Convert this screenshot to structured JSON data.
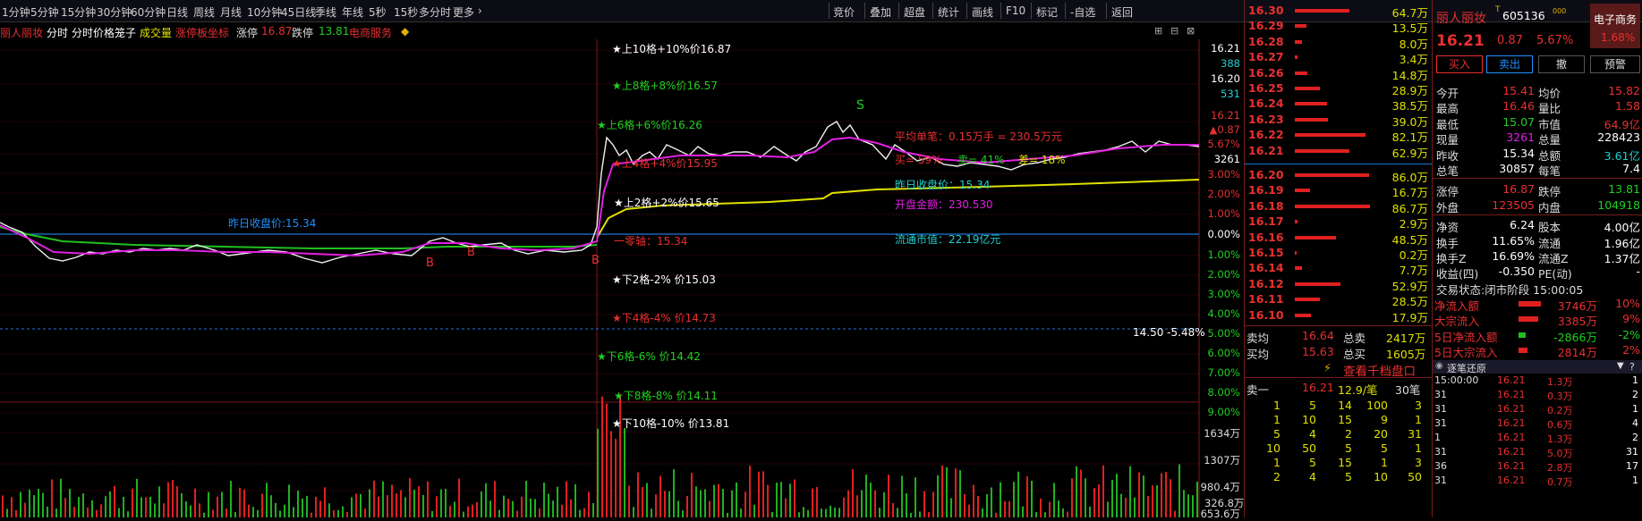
{
  "toolbar": {
    "periods": [
      "1分钟",
      "5分钟",
      "15分钟",
      "30分钟",
      "60分钟",
      "日线",
      "周线",
      "月线",
      "10分钟",
      "45日线",
      "季线",
      "年线",
      "5秒",
      "15秒",
      "多分时",
      "更多"
    ],
    "right": [
      "竞价",
      "叠加",
      "超盘",
      "统计",
      "画线",
      "F10",
      "标记",
      "-自选",
      "返回"
    ]
  },
  "chart_header": {
    "stock_name": "丽人丽妆",
    "tab_time": "分时",
    "tab_cage": "分时价格笼子",
    "volume": "成交量",
    "limit_coord": "涨停板坐标",
    "limit_up_label": "涨停",
    "limit_up_value": "16.87",
    "limit_down_label": "跌停",
    "limit_down_value": "13.81",
    "sector": "电商服务"
  },
  "cage_labels": {
    "up10": "★上10格+10%价16.87",
    "up8": "★上8格+8%价16.57",
    "up6": "★上6格+6%价16.26",
    "up4": "★上4格+4%价15.95",
    "up2": "★上2格+2%价15.65",
    "zero": "一零轴：15.34",
    "down2": "★下2格-2% 价15.03",
    "down4": "★下4格-4% 价14.73",
    "down6": "★下6格-6% 价14.42",
    "down8": "★下8格-8% 价14.11",
    "down10": "★下10格-10% 价13.81"
  },
  "annotations": {
    "prev_close_line": "昨日收盘价:15.34",
    "prev_close_info": "昨日收盘价：15.34",
    "avg_trade": "平均单笔：0.15万手 = 230.5万元",
    "buy_pct": "买= 59%",
    "sell_pct": "卖= 41%",
    "diff_pct": "差= 18%",
    "open_amount": "开盘金额：230.530",
    "float_mcap": "流通市值：22.19亿元",
    "sig_s": "S",
    "sig_b1": "B",
    "sig_b2": "B",
    "sig_b3": "B",
    "low_line": "14.50 -5.48%"
  },
  "right_axis": {
    "price_hi": "16.21",
    "vol_a": "388",
    "price_a": "16.20",
    "vol_b": "531",
    "price_cur": "16.21",
    "chg": "▲0.87",
    "chg_pct": "5.67%",
    "vol_c": "3261",
    "pct_up": [
      "3.00%",
      "2.00%",
      "1.00%"
    ],
    "pct_zero": "0.00%",
    "pct_down": [
      "1.00%",
      "2.00%",
      "3.00%",
      "4.00%",
      "5.00%",
      "6.00%",
      "7.00%",
      "8.00%",
      "9.00%"
    ],
    "vol_ticks": [
      "1634万",
      "1307万",
      "980.4万",
      "653.6万",
      "326.8万"
    ]
  },
  "orderbook": {
    "asks": [
      {
        "price": "16.30",
        "vol": "64.7万",
        "bar": 0.55
      },
      {
        "price": "16.29",
        "vol": "13.5万",
        "bar": 0.12
      },
      {
        "price": "16.28",
        "vol": "8.0万",
        "bar": 0.07
      },
      {
        "price": "16.27",
        "vol": "3.4万",
        "bar": 0.03
      },
      {
        "price": "16.26",
        "vol": "14.8万",
        "bar": 0.13
      },
      {
        "price": "16.25",
        "vol": "28.9万",
        "bar": 0.25
      },
      {
        "price": "16.24",
        "vol": "38.5万",
        "bar": 0.33
      },
      {
        "price": "16.23",
        "vol": "39.0万",
        "bar": 0.34
      },
      {
        "price": "16.22",
        "vol": "82.1万",
        "bar": 0.72
      },
      {
        "price": "16.21",
        "vol": "62.9万",
        "bar": 0.55
      }
    ],
    "bids": [
      {
        "price": "16.20",
        "vol": "86.0万",
        "bar": 0.75
      },
      {
        "price": "16.19",
        "vol": "16.7万",
        "bar": 0.15
      },
      {
        "price": "16.18",
        "vol": "86.7万",
        "bar": 0.76
      },
      {
        "price": "16.17",
        "vol": "2.9万",
        "bar": 0.03
      },
      {
        "price": "16.16",
        "vol": "48.5万",
        "bar": 0.42
      },
      {
        "price": "16.15",
        "vol": "0.2万",
        "bar": 0.01
      },
      {
        "price": "16.14",
        "vol": "7.7万",
        "bar": 0.07
      },
      {
        "price": "16.12",
        "vol": "52.9万",
        "bar": 0.46
      },
      {
        "price": "16.11",
        "vol": "28.5万",
        "bar": 0.25
      },
      {
        "price": "16.10",
        "vol": "17.9万",
        "bar": 0.16
      }
    ],
    "avg_ask_label": "卖均",
    "avg_ask": "16.64",
    "total_ask_label": "总卖",
    "total_ask": "2417万",
    "avg_bid_label": "买均",
    "avg_bid": "15.63",
    "total_bid_label": "总买",
    "total_bid": "1605万",
    "view_more": "查看千档盘口",
    "sell1_label": "卖一",
    "sell1_price": "16.21",
    "sell1_perorder": "12.9/笔",
    "sell1_count": "30笔",
    "queue": [
      [
        "1",
        "5",
        "14",
        "100",
        "3"
      ],
      [
        "1",
        "10",
        "15",
        "9",
        "1"
      ],
      [
        "5",
        "4",
        "2",
        "20",
        "31"
      ],
      [
        "10",
        "50",
        "5",
        "5",
        "1"
      ],
      [
        "1",
        "5",
        "15",
        "1",
        "3"
      ],
      [
        "2",
        "4",
        "5",
        "10",
        "50"
      ]
    ]
  },
  "quote": {
    "name": "丽人丽妆",
    "code": "605136",
    "sector_badge": "电子商务",
    "sector_badge_pct": "1.68%",
    "price": "16.21",
    "change": "0.87",
    "change_pct": "5.67%",
    "buttons": [
      "买入",
      "卖出",
      "撤",
      "预警"
    ],
    "rows": [
      [
        "今开",
        "15.41",
        "均价",
        "15.82"
      ],
      [
        "最高",
        "16.46",
        "量比",
        "1.58"
      ],
      [
        "最低",
        "15.07",
        "市值",
        "64.9亿"
      ],
      [
        "现量",
        "3261",
        "总量",
        "228423"
      ],
      [
        "昨收",
        "15.34",
        "总额",
        "3.61亿"
      ],
      [
        "总笔",
        "30857",
        "每笔",
        "7.4"
      ]
    ],
    "rows2": [
      [
        "涨停",
        "16.87",
        "跌停",
        "13.81"
      ],
      [
        "外盘",
        "123505",
        "内盘",
        "104918"
      ]
    ],
    "rows3": [
      [
        "净资",
        "6.24",
        "股本",
        "4.00亿"
      ],
      [
        "换手",
        "11.65%",
        "流通",
        "1.96亿"
      ],
      [
        "换手Z",
        "16.69%",
        "流通Z",
        "1.37亿"
      ],
      [
        "收益(四)",
        "-0.350",
        "PE(动)",
        "-"
      ]
    ],
    "trade_state": "交易状态:闭市阶段 15:00:05",
    "flows": [
      {
        "label": "净流入额",
        "value": "3746万",
        "pct": "10%",
        "bar": 0.9,
        "color": "#e02020"
      },
      {
        "label": "大宗流入",
        "value": "3385万",
        "pct": "9%",
        "bar": 0.8,
        "color": "#e02020"
      },
      {
        "label": "5日净流入额",
        "value": "-2866万",
        "pct": "-2%",
        "bar": 0.3,
        "color": "#20c020"
      },
      {
        "label": "5日大宗流入",
        "value": "2814万",
        "pct": "2%",
        "bar": 0.35,
        "color": "#e02020"
      }
    ],
    "tick_title": "逐笔还原",
    "ticks": [
      [
        "15:00:00",
        "16.21",
        "1.3万",
        "1"
      ],
      [
        "31",
        "16.21",
        "0.3万",
        "2"
      ],
      [
        "31",
        "16.21",
        "0.2万",
        "1"
      ],
      [
        "31",
        "16.21",
        "0.6万",
        "4"
      ],
      [
        "1",
        "16.21",
        "1.3万",
        "2"
      ],
      [
        "31",
        "16.21",
        "5.0万",
        "31"
      ],
      [
        "36",
        "16.21",
        "2.8万",
        "17"
      ],
      [
        "31",
        "16.21",
        "0.7万",
        "1"
      ]
    ]
  }
}
